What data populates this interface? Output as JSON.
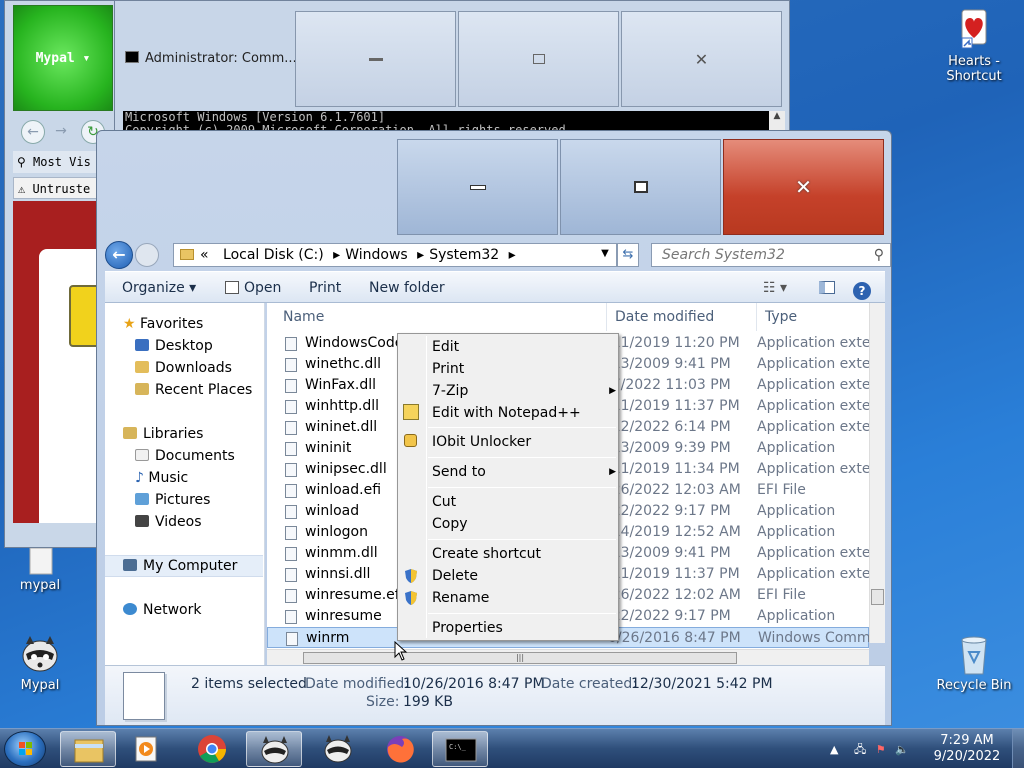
{
  "desktop": {
    "icons": [
      {
        "label": "Hearts - Shortcut"
      },
      {
        "label": "mypal"
      },
      {
        "label": "Mypal"
      },
      {
        "label": "Recycle Bin"
      }
    ]
  },
  "mypal_window": {
    "menu_button": "Mypal ▾",
    "bookmarks_label": "Most Vis",
    "tab_label": "Untruste"
  },
  "cmd_window": {
    "title": "Administrator: Comm...",
    "line1": "Microsoft Windows [Version 6.1.7601]",
    "line2": "Copyright (c) 2009 Microsoft Corporation.  All rights reserved."
  },
  "explorer": {
    "address": {
      "root": "«",
      "crumbs": [
        "Local Disk (C:)",
        "Windows",
        "System32"
      ]
    },
    "search_placeholder": "Search System32",
    "toolbar": {
      "organize": "Organize ▾",
      "open": "Open",
      "print": "Print",
      "new_folder": "New folder"
    },
    "nav": {
      "favorites": "Favorites",
      "desktop": "Desktop",
      "downloads": "Downloads",
      "recent": "Recent Places",
      "libraries": "Libraries",
      "documents": "Documents",
      "music": "Music",
      "pictures": "Pictures",
      "videos": "Videos",
      "computer": "My Computer",
      "network": "Network"
    },
    "columns": {
      "name": "Name",
      "date": "Date modified",
      "type": "Type"
    },
    "files": [
      {
        "name": "WindowsCode",
        "date": "/11/2019 11:20 PM",
        "type": "Application exter"
      },
      {
        "name": "winethc.dll",
        "date": "/13/2009 9:41 PM",
        "type": "Application exter"
      },
      {
        "name": "WinFax.dll",
        "date": "/7/2022 11:03 PM",
        "type": "Application exter"
      },
      {
        "name": "winhttp.dll",
        "date": "/11/2019 11:37 PM",
        "type": "Application exter"
      },
      {
        "name": "wininet.dll",
        "date": "/12/2022 6:14 PM",
        "type": "Application exter"
      },
      {
        "name": "wininit",
        "date": "/13/2009 9:39 PM",
        "type": "Application"
      },
      {
        "name": "winipsec.dll",
        "date": "/11/2019 11:34 PM",
        "type": "Application exter"
      },
      {
        "name": "winload.efi",
        "date": "/26/2022 12:03 AM",
        "type": "EFI File"
      },
      {
        "name": "winload",
        "date": "/22/2022 9:17 PM",
        "type": "Application"
      },
      {
        "name": "winlogon",
        "date": "/14/2019 12:52 AM",
        "type": "Application"
      },
      {
        "name": "winmm.dll",
        "date": "/13/2009 9:41 PM",
        "type": "Application exter"
      },
      {
        "name": "winnsi.dll",
        "date": "/11/2019 11:37 PM",
        "type": "Application exter"
      },
      {
        "name": "winresume.efi",
        "date": "/26/2022 12:02 AM",
        "type": "EFI File"
      },
      {
        "name": "winresume",
        "date": "/22/2022 9:17 PM",
        "type": "Application"
      },
      {
        "name": "winrm",
        "date": "0/26/2016 8:47 PM",
        "type": "Windows Comm"
      }
    ],
    "details": {
      "count": "2 items selected",
      "modified_label": "Date modified:",
      "modified": "10/26/2016 8:47 PM",
      "created_label": "Date created:",
      "created": "12/30/2021 5:42 PM",
      "size_label": "Size:",
      "size": "199 KB"
    }
  },
  "context_menu": {
    "items": [
      "Edit",
      "Print",
      "7-Zip",
      "Edit with Notepad++",
      "IObit Unlocker",
      "Send to",
      "Cut",
      "Copy",
      "Create shortcut",
      "Delete",
      "Rename",
      "Properties"
    ]
  },
  "taskbar": {
    "time": "7:29 AM",
    "date": "9/20/2022"
  },
  "colors": {
    "close_red": "#c5412a",
    "selection": "#cde3fa",
    "taskbar": "#2f4f7b"
  }
}
